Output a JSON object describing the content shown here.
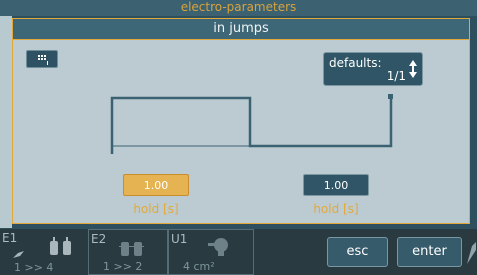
{
  "background_title": "electro-parameters",
  "dialog": {
    "title": "in jumps"
  },
  "defaults": {
    "label": "defaults:",
    "value": "1/1"
  },
  "params": [
    {
      "value": "1.00",
      "label": "hold [s]",
      "state": "active"
    },
    {
      "value": "1.00",
      "label": "hold [s]",
      "state": "idle"
    }
  ],
  "footer": {
    "e1": {
      "name": "E1",
      "sub": "1 >> 4"
    },
    "e2": {
      "name": "E2",
      "sub": "1 >> 2"
    },
    "u1": {
      "name": "U1",
      "sub": "4 cm²"
    },
    "esc_label": "esc",
    "enter_label": "enter"
  },
  "colors": {
    "accent": "#e2a93a",
    "panel": "#bccbd2",
    "dark": "#2f5566"
  }
}
